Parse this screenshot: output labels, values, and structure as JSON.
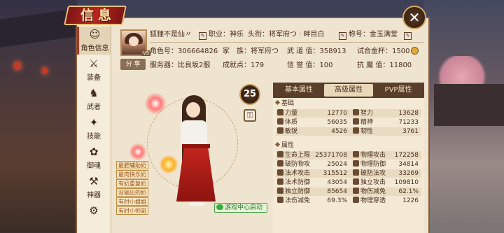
{
  "window": {
    "title": "信息",
    "close_label": "✕"
  },
  "tabs": [
    {
      "label": "角色信息",
      "icon": "portrait-icon",
      "glyph": "☺",
      "active": true
    },
    {
      "label": "装备",
      "icon": "sword-icon",
      "glyph": "⚔",
      "active": false
    },
    {
      "label": "武者",
      "icon": "warrior-icon",
      "glyph": "♞",
      "active": false
    },
    {
      "label": "技能",
      "icon": "skill-icon",
      "glyph": "✦",
      "active": false
    },
    {
      "label": "御魂",
      "icon": "soul-icon",
      "glyph": "✿",
      "active": false
    },
    {
      "label": "神器",
      "icon": "artifact-icon",
      "glyph": "⚒",
      "active": false
    },
    {
      "label": "",
      "icon": "gear-icon",
      "glyph": "⚙",
      "active": false
    }
  ],
  "profile": {
    "name": "狐狸不是仙〃",
    "vip": "V5",
    "share_label": "分 享",
    "job": "职业：神乐",
    "title": "头衔：将军府つ · 畔目白",
    "badge": "称号：金玉满堂",
    "role_id": "角色号：306664826",
    "family": "家　族：将军府つ",
    "force": "武 道 值：358913",
    "gold_test": "试合金杯：1500",
    "server": "服务器：比良坂2服",
    "achievement": "成就点：179",
    "reputation": "信 誉 值：100",
    "demon_resist": "抗 魔 值：11800"
  },
  "character": {
    "level": "25",
    "lock_glyph": "⚿",
    "tags": [
      "最肥辅助奶",
      "最肉快乐奶",
      "有奶重复奶",
      "没输出的奶",
      "有时小姐姐",
      "有时小帅哥"
    ],
    "game_center_label": "游戏中心启动"
  },
  "attr_tabs": [
    {
      "label": "基本属性",
      "active": false
    },
    {
      "label": "高级属性",
      "active": true
    },
    {
      "label": "PVP属性",
      "active": false
    }
  ],
  "sections": {
    "basic": "基础",
    "attribute": "属性"
  },
  "basic_rows": [
    {
      "l": "力量",
      "lv": "12770",
      "r": "智力",
      "rv": "13628"
    },
    {
      "l": "体质",
      "lv": "56035",
      "r": "精神",
      "rv": "71233"
    },
    {
      "l": "敏锐",
      "lv": "4526",
      "r": "韧性",
      "rv": "3761"
    }
  ],
  "attr_rows": [
    {
      "l": "生命上限",
      "lv": "25371708",
      "r": "物理攻击",
      "rv": "172258"
    },
    {
      "l": "破防物攻",
      "lv": "25024",
      "r": "物理防御",
      "rv": "34814"
    },
    {
      "l": "法术攻击",
      "lv": "315512",
      "r": "破防法攻",
      "rv": "33269"
    },
    {
      "l": "法术防御",
      "lv": "43054",
      "r": "独立攻击",
      "rv": "109810"
    },
    {
      "l": "独立防御",
      "lv": "85654",
      "r": "物伤减免",
      "rv": "62.1%"
    },
    {
      "l": "法伤减免",
      "lv": "69.3%",
      "r": "物理穿透",
      "rv": "1226"
    }
  ],
  "colors": {
    "accent": "#b0351f",
    "panel": "#efe4cf",
    "frame": "#8a5a3a"
  }
}
